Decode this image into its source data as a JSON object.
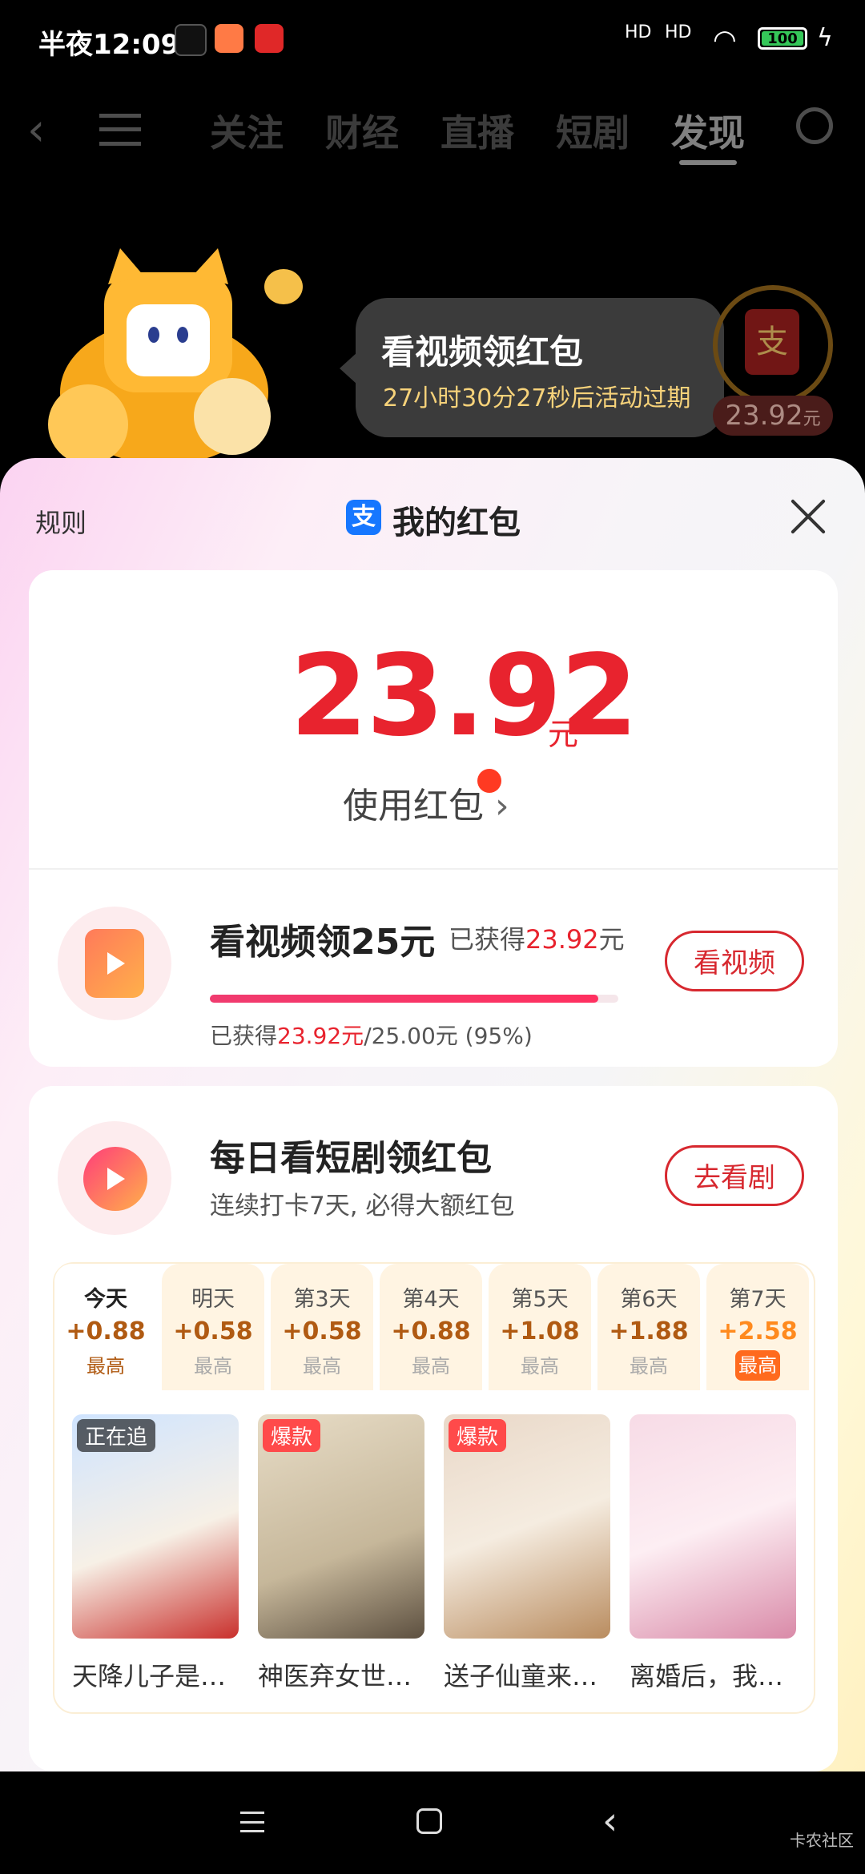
{
  "status": {
    "time": "半夜12:09",
    "net1": "HD",
    "net2": "HD",
    "battery": "100"
  },
  "nav": {
    "tabs": [
      "关注",
      "财经",
      "直播",
      "短剧",
      "发现"
    ],
    "active": "发现"
  },
  "promo": {
    "title": "看视频领红包",
    "countdown": "27小时30分27秒后活动过期",
    "ring_amount": "23.92",
    "ring_unit": "元",
    "ring_icon": "支"
  },
  "sheet": {
    "rules": "规则",
    "title": "我的红包",
    "alipay_icon": "支",
    "amount": "23.92",
    "unit": "元",
    "use_label": "使用红包"
  },
  "task1": {
    "title": "看视频领25元",
    "earned_prefix": "已获得",
    "earned_amount": "23.92",
    "earned_unit": "元",
    "progress_prefix": "已获得",
    "progress_amount": "23.92元",
    "progress_rest": "/25.00元 (95%)",
    "progress_fraction": 0.95,
    "button": "看视频"
  },
  "task2": {
    "title": "每日看短剧领红包",
    "subtitle": "连续打卡7天, 必得大额红包",
    "button": "去看剧",
    "days": [
      {
        "label": "今天",
        "value": "+0.88",
        "max": "最高"
      },
      {
        "label": "明天",
        "value": "+0.58",
        "max": "最高"
      },
      {
        "label": "第3天",
        "value": "+0.58",
        "max": "最高"
      },
      {
        "label": "第4天",
        "value": "+0.88",
        "max": "最高"
      },
      {
        "label": "第5天",
        "value": "+1.08",
        "max": "最高"
      },
      {
        "label": "第6天",
        "value": "+1.88",
        "max": "最高"
      },
      {
        "label": "第7天",
        "value": "+2.58",
        "max": "最高"
      }
    ],
    "dramas": [
      {
        "title": "天降儿子是…",
        "tag": "正在追"
      },
      {
        "title": "神医弃女世…",
        "tag": "爆款"
      },
      {
        "title": "送子仙童来…",
        "tag": "爆款"
      },
      {
        "title": "离婚后，我…",
        "tag": ""
      }
    ]
  },
  "watermark": "卡农社区",
  "colors": {
    "accent": "#e8232e",
    "brand_blue": "#1677ff"
  }
}
